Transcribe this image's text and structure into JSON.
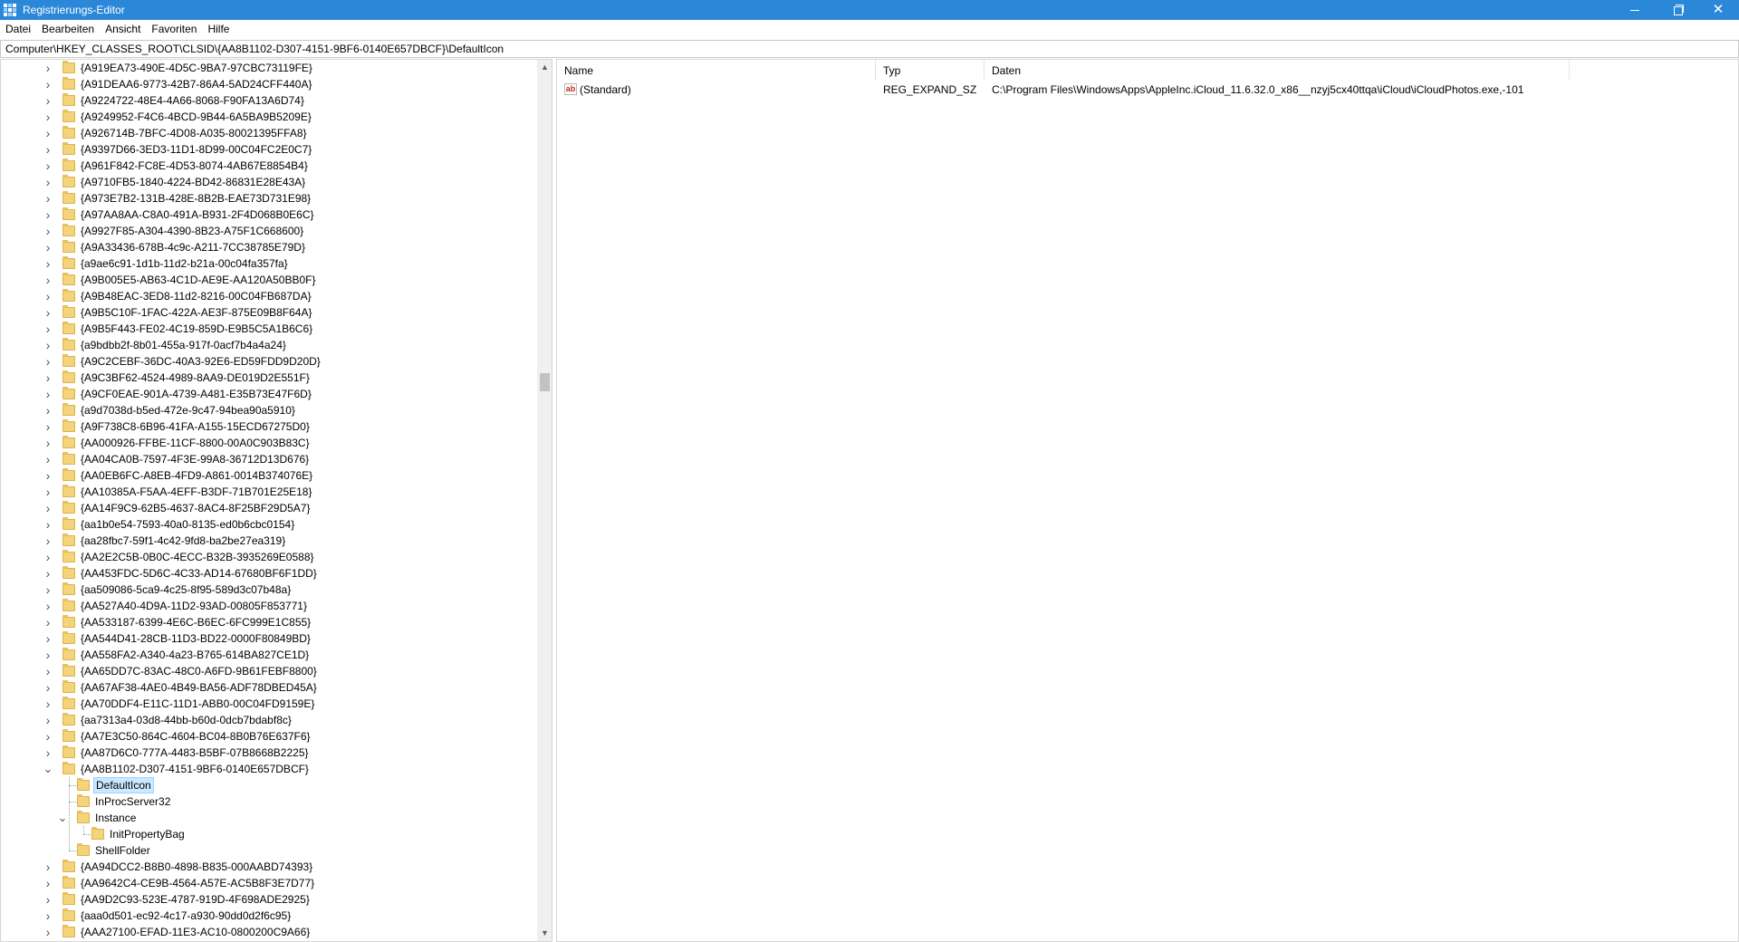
{
  "window": {
    "title": "Registrierungs-Editor"
  },
  "menu": [
    "Datei",
    "Bearbeiten",
    "Ansicht",
    "Favoriten",
    "Hilfe"
  ],
  "address": "Computer\\HKEY_CLASSES_ROOT\\CLSID\\{AA8B1102-D307-4151-9BF6-0140E657DBCF}\\DefaultIcon",
  "tree": {
    "keys_before": [
      "{A919EA73-490E-4D5C-9BA7-97CBC73119FE}",
      "{A91DEAA6-9773-42B7-86A4-5AD24CFF440A}",
      "{A9224722-48E4-4A66-8068-F90FA13A6D74}",
      "{A9249952-F4C6-4BCD-9B44-6A5BA9B5209E}",
      "{A926714B-7BFC-4D08-A035-80021395FFA8}",
      "{A9397D66-3ED3-11D1-8D99-00C04FC2E0C7}",
      "{A961F842-FC8E-4D53-8074-4AB67E8854B4}",
      "{A9710FB5-1840-4224-BD42-86831E28E43A}",
      "{A973E7B2-131B-428E-8B2B-EAE73D731E98}",
      "{A97AA8AA-C8A0-491A-B931-2F4D068B0E6C}",
      "{A9927F85-A304-4390-8B23-A75F1C668600}",
      "{A9A33436-678B-4c9c-A211-7CC38785E79D}",
      "{a9ae6c91-1d1b-11d2-b21a-00c04fa357fa}",
      "{A9B005E5-AB63-4C1D-AE9E-AA120A50BB0F}",
      "{A9B48EAC-3ED8-11d2-8216-00C04FB687DA}",
      "{A9B5C10F-1FAC-422A-AE3F-875E09B8F64A}",
      "{A9B5F443-FE02-4C19-859D-E9B5C5A1B6C6}",
      "{a9bdbb2f-8b01-455a-917f-0acf7b4a4a24}",
      "{A9C2CEBF-36DC-40A3-92E6-ED59FDD9D20D}",
      "{A9C3BF62-4524-4989-8AA9-DE019D2E551F}",
      "{A9CF0EAE-901A-4739-A481-E35B73E47F6D}",
      "{a9d7038d-b5ed-472e-9c47-94bea90a5910}",
      "{A9F738C8-6B96-41FA-A155-15ECD67275D0}",
      "{AA000926-FFBE-11CF-8800-00A0C903B83C}",
      "{AA04CA0B-7597-4F3E-99A8-36712D13D676}",
      "{AA0EB6FC-A8EB-4FD9-A861-0014B374076E}",
      "{AA10385A-F5AA-4EFF-B3DF-71B701E25E18}",
      "{AA14F9C9-62B5-4637-8AC4-8F25BF29D5A7}",
      "{aa1b0e54-7593-40a0-8135-ed0b6cbc0154}",
      "{aa28fbc7-59f1-4c42-9fd8-ba2be27ea319}",
      "{AA2E2C5B-0B0C-4ECC-B32B-3935269E0588}",
      "{AA453FDC-5D6C-4C33-AD14-67680BF6F1DD}",
      "{aa509086-5ca9-4c25-8f95-589d3c07b48a}",
      "{AA527A40-4D9A-11D2-93AD-00805F853771}",
      "{AA533187-6399-4E6C-B6EC-6FC999E1C855}",
      "{AA544D41-28CB-11D3-BD22-0000F80849BD}",
      "{AA558FA2-A340-4a23-B765-614BA827CE1D}",
      "{AA65DD7C-83AC-48C0-A6FD-9B61FEBF8800}",
      "{AA67AF38-4AE0-4B49-BA56-ADF78DBED45A}",
      "{AA70DDF4-E11C-11D1-ABB0-00C04FD9159E}",
      "{aa7313a4-03d8-44bb-b60d-0dcb7bdabf8c}",
      "{AA7E3C50-864C-4604-BC04-8B0B76E637F6}",
      "{AA87D6C0-777A-4483-B5BF-07B8668B2225}"
    ],
    "expanded_key": "{AA8B1102-D307-4151-9BF6-0140E657DBCF}",
    "children": {
      "default_icon": "DefaultIcon",
      "inproc": "InProcServer32",
      "instance": "Instance",
      "init_property_bag": "InitPropertyBag",
      "shell_folder": "ShellFolder"
    },
    "keys_after": [
      "{AA94DCC2-B8B0-4898-B835-000AABD74393}",
      "{AA9642C4-CE9B-4564-A57E-AC5B8F3E7D77}",
      "{AA9D2C93-523E-4787-919D-4F698ADE2925}",
      "{aaa0d501-ec92-4c17-a930-90dd0d2f6c95}",
      "{AAA27100-EFAD-11E3-AC10-0800200C9A66}"
    ]
  },
  "list": {
    "columns": {
      "name": "Name",
      "type": "Typ",
      "data": "Daten"
    },
    "rows": [
      {
        "icon": "string-value-ab-icon",
        "name": "(Standard)",
        "type": "REG_EXPAND_SZ",
        "data": "C:\\Program Files\\WindowsApps\\AppleInc.iCloud_11.6.32.0_x86__nzyj5cx40ttqa\\iCloud\\iCloudPhotos.exe,-101"
      }
    ]
  },
  "colors": {
    "titlebar": "#2b88d8",
    "selection": "#cce8ff",
    "folder": "#f4d47a"
  }
}
